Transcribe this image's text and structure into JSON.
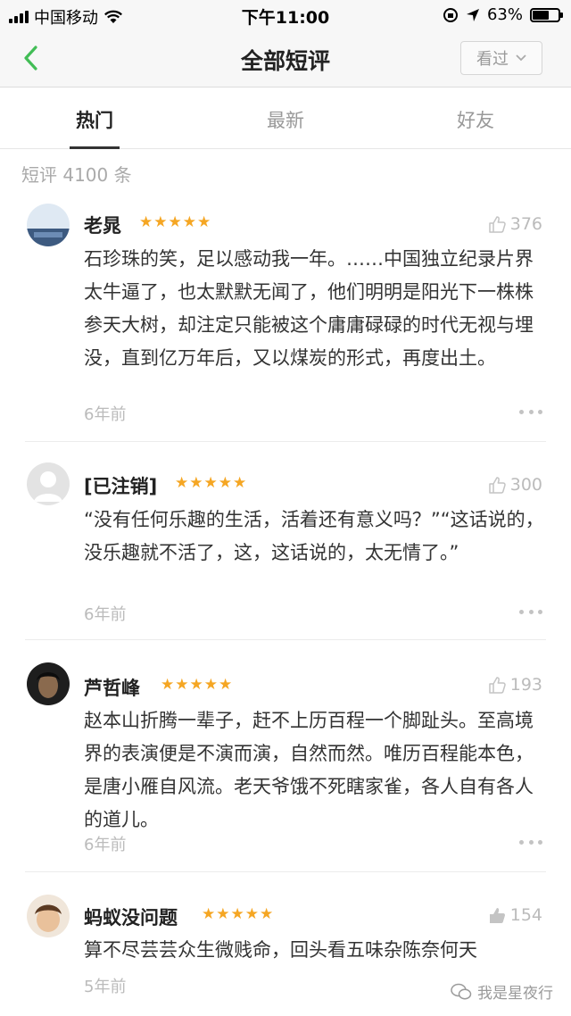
{
  "status_bar": {
    "carrier": "中国移动",
    "time": "下午11:00",
    "battery_percent": "63%",
    "battery_level": 0.63
  },
  "nav": {
    "title": "全部短评",
    "filter_label": "看过"
  },
  "tabs": [
    {
      "label": "热门",
      "active": true
    },
    {
      "label": "最新",
      "active": false
    },
    {
      "label": "好友",
      "active": false
    }
  ],
  "summary": {
    "count_text": "短评 4100 条"
  },
  "reviews": [
    {
      "name": "老晁",
      "stars": "★★★★★",
      "likes": "376",
      "content": "石珍珠的笑，足以感动我一年。……中国独立纪录片界太牛逼了，也太默默无闻了，他们明明是阳光下一株株参天大树，却注定只能被这个庸庸碌碌的时代无视与埋没，直到亿万年后，又以煤炭的形式，再度出土。",
      "time": "6年前",
      "avatar_color": "#4a6fa5"
    },
    {
      "name": "[已注销]",
      "stars": "★★★★★",
      "likes": "300",
      "content": "“没有任何乐趣的生活，活着还有意义吗？”“这话说的，没乐趣就不活了，这，这话说的，太无情了。”",
      "time": "6年前",
      "avatar_color": "#e0e0e0"
    },
    {
      "name": "芦哲峰",
      "stars": "★★★★★",
      "likes": "193",
      "content": "赵本山折腾一辈子，赶不上历百程一个脚趾头。至高境界的表演便是不演而演，自然而然。唯历百程能本色，是唐小雁自风流。老天爷饿不死瞎家雀，各人自有各人的道儿。",
      "time": "6年前",
      "avatar_color": "#2b2b2b"
    },
    {
      "name": "蚂蚁没问题",
      "stars": "★★★★★",
      "likes": "154",
      "content": "算不尽芸芸众生微贱命，回头看五味杂陈奈何天",
      "time": "5年前",
      "avatar_color": "#c9a27a"
    }
  ],
  "watermark": {
    "text": "我是星夜行"
  }
}
